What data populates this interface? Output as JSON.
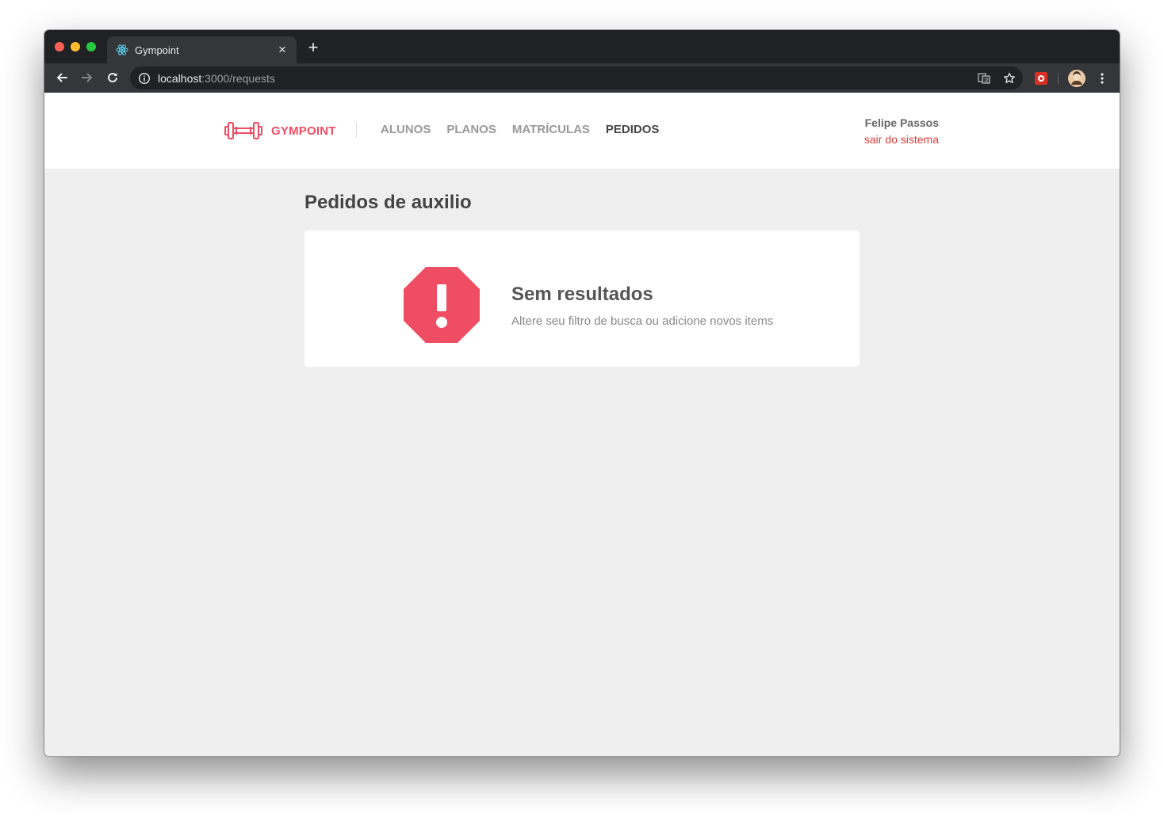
{
  "browser": {
    "tab_title": "Gympoint",
    "url_host": "localhost",
    "url_path": ":3000/requests",
    "icons": [
      "react-favicon-icon",
      "close-icon",
      "plus-icon",
      "back-icon",
      "forward-icon",
      "reload-icon",
      "info-icon",
      "translate-icon",
      "star-icon",
      "extension-icon",
      "profile-avatar-icon",
      "more-menu-icon"
    ]
  },
  "header": {
    "brand": "GYMPOINT",
    "nav": [
      {
        "label": "ALUNOS"
      },
      {
        "label": "PLANOS"
      },
      {
        "label": "MATRÍCULAS"
      },
      {
        "label": "PEDIDOS",
        "active": true
      }
    ],
    "user_name": "Felipe Passos",
    "logout_label": "sair do sistema"
  },
  "main": {
    "title": "Pedidos de auxilio",
    "empty_state": {
      "title": "Sem resultados",
      "subtitle": "Altere seu filtro de busca ou adicione novos items"
    }
  },
  "colors": {
    "brand": "#ee4d64",
    "logout": "#de3b3b",
    "background": "#efefef"
  }
}
